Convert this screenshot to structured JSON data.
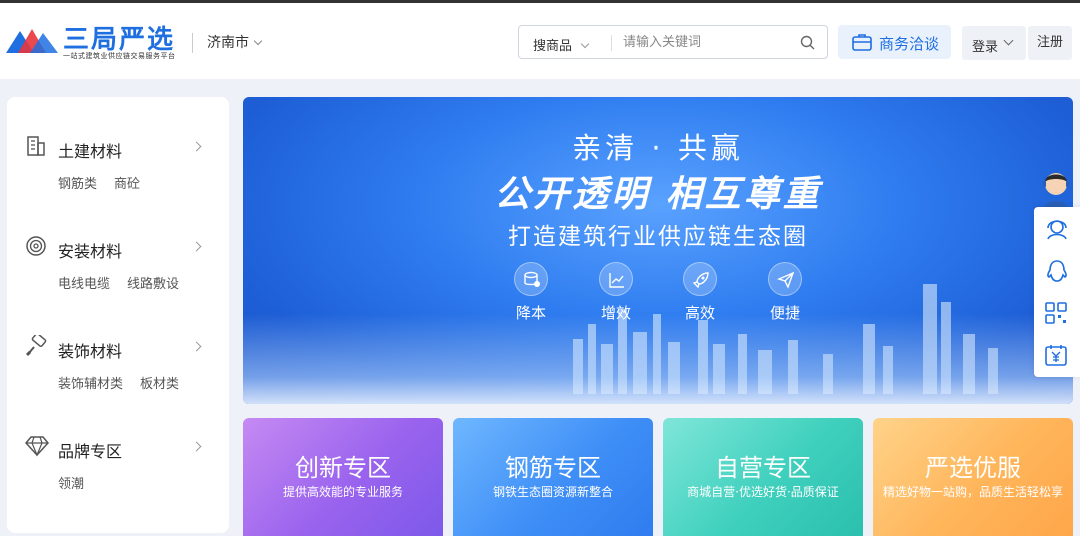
{
  "brand": {
    "title": "三局严选",
    "subtitle": "一站式建筑业供应链交易服务平台",
    "colors": {
      "primary": "#1f6fe0",
      "red": "#e8353c"
    }
  },
  "header": {
    "city": "济南市",
    "search": {
      "type_label": "搜商品",
      "placeholder": "请输入关键词"
    },
    "business_label": "商务洽谈",
    "login_label": "登录",
    "register_label": "注册"
  },
  "sidebar": {
    "categories": [
      {
        "title": "土建材料",
        "icon": "building-icon",
        "subs": [
          "钢筋类",
          "商砼"
        ]
      },
      {
        "title": "安装材料",
        "icon": "cable-roll-icon",
        "subs": [
          "电线电缆",
          "线路敷设"
        ]
      },
      {
        "title": "装饰材料",
        "icon": "paint-roller-icon",
        "subs": [
          "装饰辅材类",
          "板材类"
        ]
      },
      {
        "title": "品牌专区",
        "icon": "diamond-icon",
        "subs": [
          "领潮"
        ]
      }
    ]
  },
  "banner": {
    "line1": "亲清 · 共赢",
    "line2": "公开透明  相互尊重",
    "line3": "打造建筑行业供应链生态圈",
    "features": [
      {
        "label": "降本",
        "icon": "coins-icon"
      },
      {
        "label": "增效",
        "icon": "trend-chart-icon"
      },
      {
        "label": "高效",
        "icon": "rocket-icon"
      },
      {
        "label": "便捷",
        "icon": "send-icon"
      }
    ]
  },
  "zones": [
    {
      "title": "创新专区",
      "subtitle": "提供高效能的专业服务"
    },
    {
      "title": "钢筋专区",
      "subtitle": "钢铁生态圈资源新整合"
    },
    {
      "title": "自营专区",
      "subtitle": "商城自营·优选好货·品质保证"
    },
    {
      "title": "严选优服",
      "subtitle": "精选好物一站购，品质生活轻松享"
    }
  ],
  "float_bar": {
    "items": [
      "customer-service-icon",
      "qq-icon",
      "qrcode-icon",
      "calendar-yuan-icon"
    ]
  }
}
